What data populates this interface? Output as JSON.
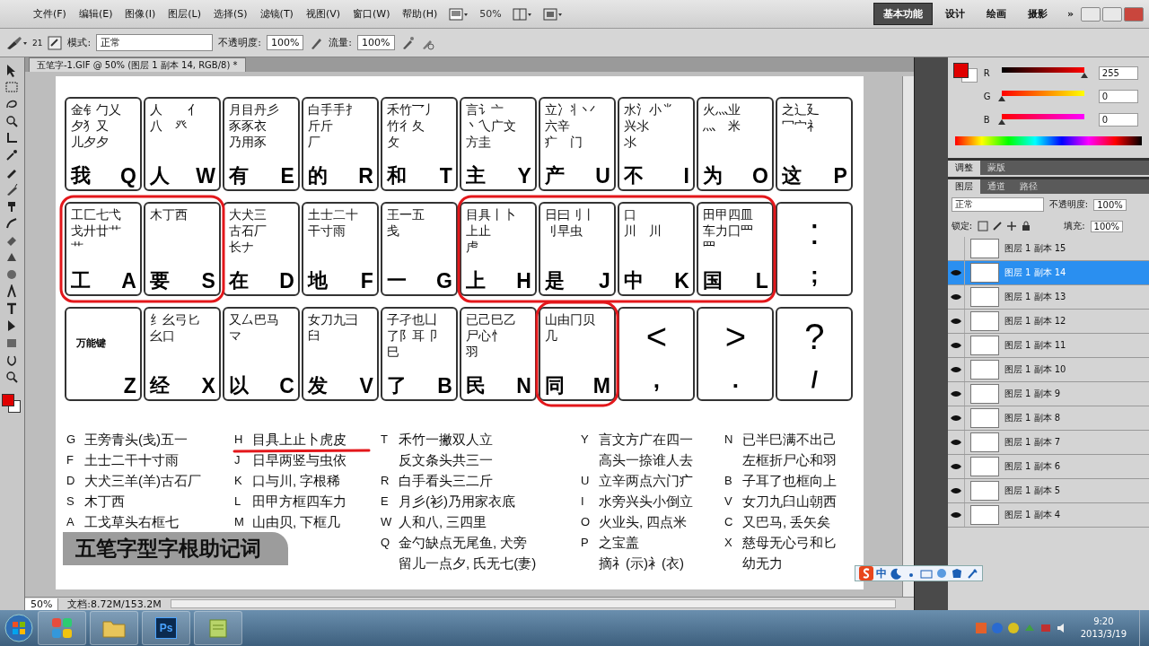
{
  "menubar": {
    "menus": [
      "文件(F)",
      "编辑(E)",
      "图像(I)",
      "图层(L)",
      "选择(S)",
      "滤镜(T)",
      "视图(V)",
      "窗口(W)",
      "帮助(H)"
    ],
    "zoom": "50%",
    "workspaces": [
      {
        "label": "基本功能",
        "selected": true
      },
      {
        "label": "设计",
        "selected": false
      },
      {
        "label": "绘画",
        "selected": false
      },
      {
        "label": "摄影",
        "selected": false
      }
    ],
    "more": "»"
  },
  "options_bar": {
    "brush_size": "21",
    "mode_label": "模式:",
    "mode": "正常",
    "opacity_label": "不透明度:",
    "opacity": "100%",
    "flow_label": "流量:",
    "flow": "100%"
  },
  "document": {
    "tab_title": "五笔字-1.GIF @ 50% (图层 1 副本 14, RGB/8) *",
    "keyboard_rows": [
      [
        {
          "kind": "root",
          "radicals": [
            "金钅勹乂",
            "夕犭又",
            "儿夕夕"
          ],
          "char": "我",
          "letter": "Q"
        },
        {
          "kind": "root",
          "radicals": [
            "人　　亻",
            "八　癶"
          ],
          "char": "人",
          "letter": "W"
        },
        {
          "kind": "root",
          "radicals": [
            "月目丹彡",
            "豕豕衣",
            "乃用豕"
          ],
          "char": "有",
          "letter": "E"
        },
        {
          "kind": "root",
          "radicals": [
            "白手手扌",
            "斤斤",
            "厂"
          ],
          "char": "的",
          "letter": "R"
        },
        {
          "kind": "root",
          "radicals": [
            "禾竹乛丿",
            "竹彳夂",
            "攵"
          ],
          "char": "和",
          "letter": "T"
        },
        {
          "kind": "root",
          "radicals": [
            "言讠亠",
            "丶乀广文",
            "方圭"
          ],
          "char": "主",
          "letter": "Y"
        },
        {
          "kind": "root",
          "radicals": [
            "立冫丬丷",
            "六辛",
            "疒　门"
          ],
          "char": "产",
          "letter": "U"
        },
        {
          "kind": "root",
          "radicals": [
            "水氵小⺌",
            "兴氺",
            "氺"
          ],
          "char": "不",
          "letter": "I"
        },
        {
          "kind": "root",
          "radicals": [
            "火灬业",
            "灬　米"
          ],
          "char": "为",
          "letter": "O"
        },
        {
          "kind": "root",
          "radicals": [
            "之辶廴",
            "冖宀礻"
          ],
          "char": "这",
          "letter": "P"
        }
      ],
      [
        {
          "kind": "root",
          "radicals": [
            "工匚七弋",
            "戈廾廿艹",
            "艹"
          ],
          "char": "工",
          "letter": "A"
        },
        {
          "kind": "root",
          "radicals": [
            "木丁西"
          ],
          "char": "要",
          "letter": "S"
        },
        {
          "kind": "root",
          "radicals": [
            "大犬三",
            "古石厂",
            "长ナ"
          ],
          "char": "在",
          "letter": "D"
        },
        {
          "kind": "root",
          "radicals": [
            "土士二十",
            "干寸雨"
          ],
          "char": "地",
          "letter": "F"
        },
        {
          "kind": "root",
          "radicals": [
            "王一五",
            "戋"
          ],
          "char": "一",
          "letter": "G"
        },
        {
          "kind": "root",
          "radicals": [
            "目具丨卜",
            "上止",
            "虍"
          ],
          "char": "上",
          "letter": "H"
        },
        {
          "kind": "root",
          "radicals": [
            "日曰刂丨",
            "刂早虫"
          ],
          "char": "是",
          "letter": "J"
        },
        {
          "kind": "root",
          "radicals": [
            "口",
            "川　川"
          ],
          "char": "中",
          "letter": "K"
        },
        {
          "kind": "root",
          "radicals": [
            "田甲四皿",
            "车力囗罒",
            "罒"
          ],
          "char": "国",
          "letter": "L"
        },
        {
          "kind": "punct",
          "upper": ":",
          "lower": ";"
        }
      ],
      [
        {
          "kind": "wildcard",
          "label": "万能键",
          "letter": "Z"
        },
        {
          "kind": "root",
          "radicals": [
            "纟幺弓匕",
            "幺口"
          ],
          "char": "经",
          "letter": "X"
        },
        {
          "kind": "root",
          "radicals": [
            "又厶巴马",
            "マ"
          ],
          "char": "以",
          "letter": "C"
        },
        {
          "kind": "root",
          "radicals": [
            "女刀九彐",
            "臼"
          ],
          "char": "发",
          "letter": "V"
        },
        {
          "kind": "root",
          "radicals": [
            "子孑也凵",
            "了阝耳卩",
            "巳"
          ],
          "char": "了",
          "letter": "B"
        },
        {
          "kind": "root",
          "radicals": [
            "已己巳乙",
            "尸心忄",
            "羽"
          ],
          "char": "民",
          "letter": "N"
        },
        {
          "kind": "root",
          "radicals": [
            "山由冂贝",
            "几"
          ],
          "char": "同",
          "letter": "M"
        },
        {
          "kind": "punct",
          "upper": "<",
          "lower": ","
        },
        {
          "kind": "punct",
          "upper": ">",
          "lower": "."
        },
        {
          "kind": "punct",
          "upper": "?",
          "lower": "/"
        }
      ]
    ],
    "mnemonic_columns": [
      [
        {
          "key": "G",
          "lines": [
            "王旁青头(戋)五一"
          ]
        },
        {
          "key": "F",
          "lines": [
            "土士二干十寸雨"
          ]
        },
        {
          "key": "D",
          "lines": [
            "大犬三羊(羊)古石厂"
          ]
        },
        {
          "key": "S",
          "lines": [
            "木丁西"
          ]
        },
        {
          "key": "A",
          "lines": [
            "工戈草头右框七"
          ]
        }
      ],
      [
        {
          "key": "H",
          "lines": [
            "目具上止卜虎皮"
          ]
        },
        {
          "key": "J",
          "lines": [
            "日早两竖与虫依"
          ]
        },
        {
          "key": "K",
          "lines": [
            "口与川, 字根稀"
          ]
        },
        {
          "key": "L",
          "lines": [
            "田甲方框四车力"
          ]
        },
        {
          "key": "M",
          "lines": [
            "山由贝, 下框几"
          ]
        }
      ],
      [
        {
          "key": "T",
          "lines": [
            "禾竹一撇双人立",
            "反文条头共三一"
          ]
        },
        {
          "key": "R",
          "lines": [
            "白手看头三二斤"
          ]
        },
        {
          "key": "E",
          "lines": [
            "月彡(衫)乃用家衣底"
          ]
        },
        {
          "key": "W",
          "lines": [
            "人和八, 三四里"
          ]
        },
        {
          "key": "Q",
          "lines": [
            "金勺缺点无尾鱼, 犬旁",
            "留儿一点夕, 氏无七(妻)"
          ]
        }
      ],
      [
        {
          "key": "Y",
          "lines": [
            "言文方广在四一",
            "高头一捺谁人去"
          ]
        },
        {
          "key": "U",
          "lines": [
            "立辛两点六门疒"
          ]
        },
        {
          "key": "I",
          "lines": [
            "水旁兴头小倒立"
          ]
        },
        {
          "key": "O",
          "lines": [
            "火业头, 四点米"
          ]
        },
        {
          "key": "P",
          "lines": [
            "之宝盖",
            "摘礻(示)衤(衣)"
          ]
        }
      ],
      [
        {
          "key": "N",
          "lines": [
            "已半巳满不出己",
            "左框折尸心和羽"
          ]
        },
        {
          "key": "B",
          "lines": [
            "子耳了也框向上"
          ]
        },
        {
          "key": "V",
          "lines": [
            "女刀九臼山朝西"
          ]
        },
        {
          "key": "C",
          "lines": [
            "又巴马, 丢矢矣"
          ]
        },
        {
          "key": "X",
          "lines": [
            "慈母无心弓和匕",
            "幼无力"
          ]
        }
      ]
    ],
    "title": "五笔字型字根助记词"
  },
  "status_bar": {
    "zoom": "50%",
    "doc_size": "文档:8.72M/153.2M"
  },
  "color_panel": {
    "channels": [
      {
        "name": "R",
        "value": "255",
        "level": 1
      },
      {
        "name": "G",
        "value": "0",
        "level": 0
      },
      {
        "name": "B",
        "value": "0",
        "level": 0
      }
    ]
  },
  "panel_tabs": [
    {
      "label": "调整",
      "selected": true
    },
    {
      "label": "蒙版",
      "selected": false
    }
  ],
  "layers_panel": {
    "tabs": [
      {
        "label": "图层",
        "selected": true
      },
      {
        "label": "通道",
        "selected": false
      },
      {
        "label": "路径",
        "selected": false
      }
    ],
    "blend_mode": "正常",
    "opacity_label": "不透明度:",
    "opacity": "100%",
    "lock_label": "锁定:",
    "fill_label": "填充:",
    "fill": "100%",
    "layers": [
      {
        "name": "图层 1 副本 15",
        "visible": false,
        "selected": false
      },
      {
        "name": "图层 1 副本 14",
        "visible": true,
        "selected": true
      },
      {
        "name": "图层 1 副本 13",
        "visible": true,
        "selected": false
      },
      {
        "name": "图层 1 副本 12",
        "visible": true,
        "selected": false
      },
      {
        "name": "图层 1 副本 11",
        "visible": true,
        "selected": false
      },
      {
        "name": "图层 1 副本 10",
        "visible": true,
        "selected": false
      },
      {
        "name": "图层 1 副本 9",
        "visible": true,
        "selected": false
      },
      {
        "name": "图层 1 副本 8",
        "visible": true,
        "selected": false
      },
      {
        "name": "图层 1 副本 7",
        "visible": true,
        "selected": false
      },
      {
        "name": "图层 1 副本 6",
        "visible": true,
        "selected": false
      },
      {
        "name": "图层 1 副本 5",
        "visible": true,
        "selected": false
      },
      {
        "name": "图层 1 副本 4",
        "visible": true,
        "selected": false
      }
    ]
  },
  "ime_bar": {
    "mode": "中"
  },
  "taskbar": {
    "apps": [
      {
        "kind": "tiles"
      },
      {
        "kind": "folder"
      },
      {
        "kind": "photoshop",
        "label": "Ps"
      },
      {
        "kind": "notepad"
      }
    ],
    "time": "9:20",
    "date": "2013/3/19"
  }
}
